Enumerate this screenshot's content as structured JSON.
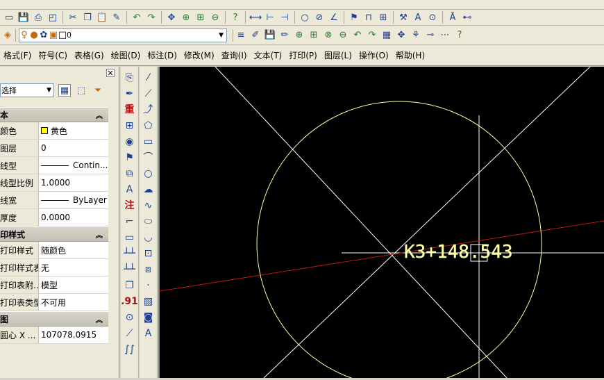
{
  "menubar": {
    "items": [
      "格式(F)",
      "符号(C)",
      "表格(G)",
      "绘图(D)",
      "标注(D)",
      "修改(M)",
      "查询(I)",
      "文本(T)",
      "打印(P)",
      "图层(L)",
      "操作(O)",
      "帮助(H)"
    ]
  },
  "layer_toolbar": {
    "current_layer": "0"
  },
  "properties": {
    "selection": "选择",
    "sections": [
      {
        "title": "本",
        "rows": [
          {
            "name": "颜色",
            "value": "黄色",
            "swatch": "#ffff00"
          },
          {
            "name": "图层",
            "value": "0"
          },
          {
            "name": "线型",
            "value": "Contin...",
            "line": true
          },
          {
            "name": "线型比例",
            "value": "1.0000"
          },
          {
            "name": "线宽",
            "value": "ByLayer",
            "line": true
          },
          {
            "name": "厚度",
            "value": "0.0000"
          }
        ]
      },
      {
        "title": "印样式",
        "rows": [
          {
            "name": "打印样式",
            "value": "随颜色"
          },
          {
            "name": "打印样式表",
            "value": "无"
          },
          {
            "name": "打印表附...",
            "value": "模型"
          },
          {
            "name": "打印表类型",
            "value": "不可用"
          }
        ]
      },
      {
        "title": "图",
        "rows": [
          {
            "name": "圆心 X ...",
            "value": "107078.0915"
          }
        ]
      }
    ]
  },
  "drawing": {
    "annotation": "K3+148.543",
    "colors": {
      "background": "#000000",
      "white_lines": "#ffffff",
      "circle": "#ffffaa",
      "red_line": "#c01818",
      "text": "#ffffaa"
    }
  },
  "toolbar_icons": {
    "row1": [
      "open-icon",
      "save-icon",
      "print-icon",
      "preview-icon",
      "cut-icon",
      "copy-icon",
      "paste-icon",
      "brush-icon",
      "undo-icon",
      "redo-icon",
      "pan-icon",
      "zoom-realtime-icon",
      "zoom-window-icon",
      "zoom-prev-icon",
      "help-icon",
      "dim-linear-icon",
      "dim-aligned-icon",
      "dim-baseline-icon",
      "circle-icon",
      "no-icon",
      "angle-icon",
      "flag-icon",
      "frame-icon",
      "grid-icon",
      "tool-icon",
      "ruler-icon",
      "center-icon",
      "text-icon",
      "measure-icon"
    ],
    "row2": [
      "layer-manager-icon",
      "bulb-icon",
      "sun-icon",
      "lock-icon",
      "color-icon"
    ],
    "row2b": [
      "lineweight-icon",
      "match-icon",
      "save-icon",
      "pencil-icon",
      "zoom-in-icon",
      "zoom-window-icon",
      "zoom-all-icon",
      "zoom-prev-icon",
      "undo-icon",
      "redo-icon",
      "table-icon",
      "move-icon",
      "scale-icon",
      "dim-continue-icon",
      "dim-break-icon",
      "help-icon"
    ]
  },
  "left_tools": [
    "doc-icon",
    "pen-icon",
    "重",
    "grid-icon",
    "camera-icon",
    "tag-icon",
    "layers-icon",
    "ruler-icon",
    "注",
    "corner-icon",
    "rect-icon",
    "dim-icon",
    "dim2-icon",
    "copy-icon",
    ".91",
    "target-icon",
    "slash-icon",
    "wave-icon"
  ],
  "draw_tools": [
    "line-icon",
    "polyline-icon",
    "arc-icon",
    "polygon-icon",
    "rect-icon",
    "arc2-icon",
    "circle-icon",
    "cloud-icon",
    "spline-icon",
    "ellipse-icon",
    "ellipse-arc-icon",
    "insert-icon",
    "block-icon",
    "point-icon",
    "hatch-icon",
    "region-icon",
    "text-a-icon"
  ]
}
